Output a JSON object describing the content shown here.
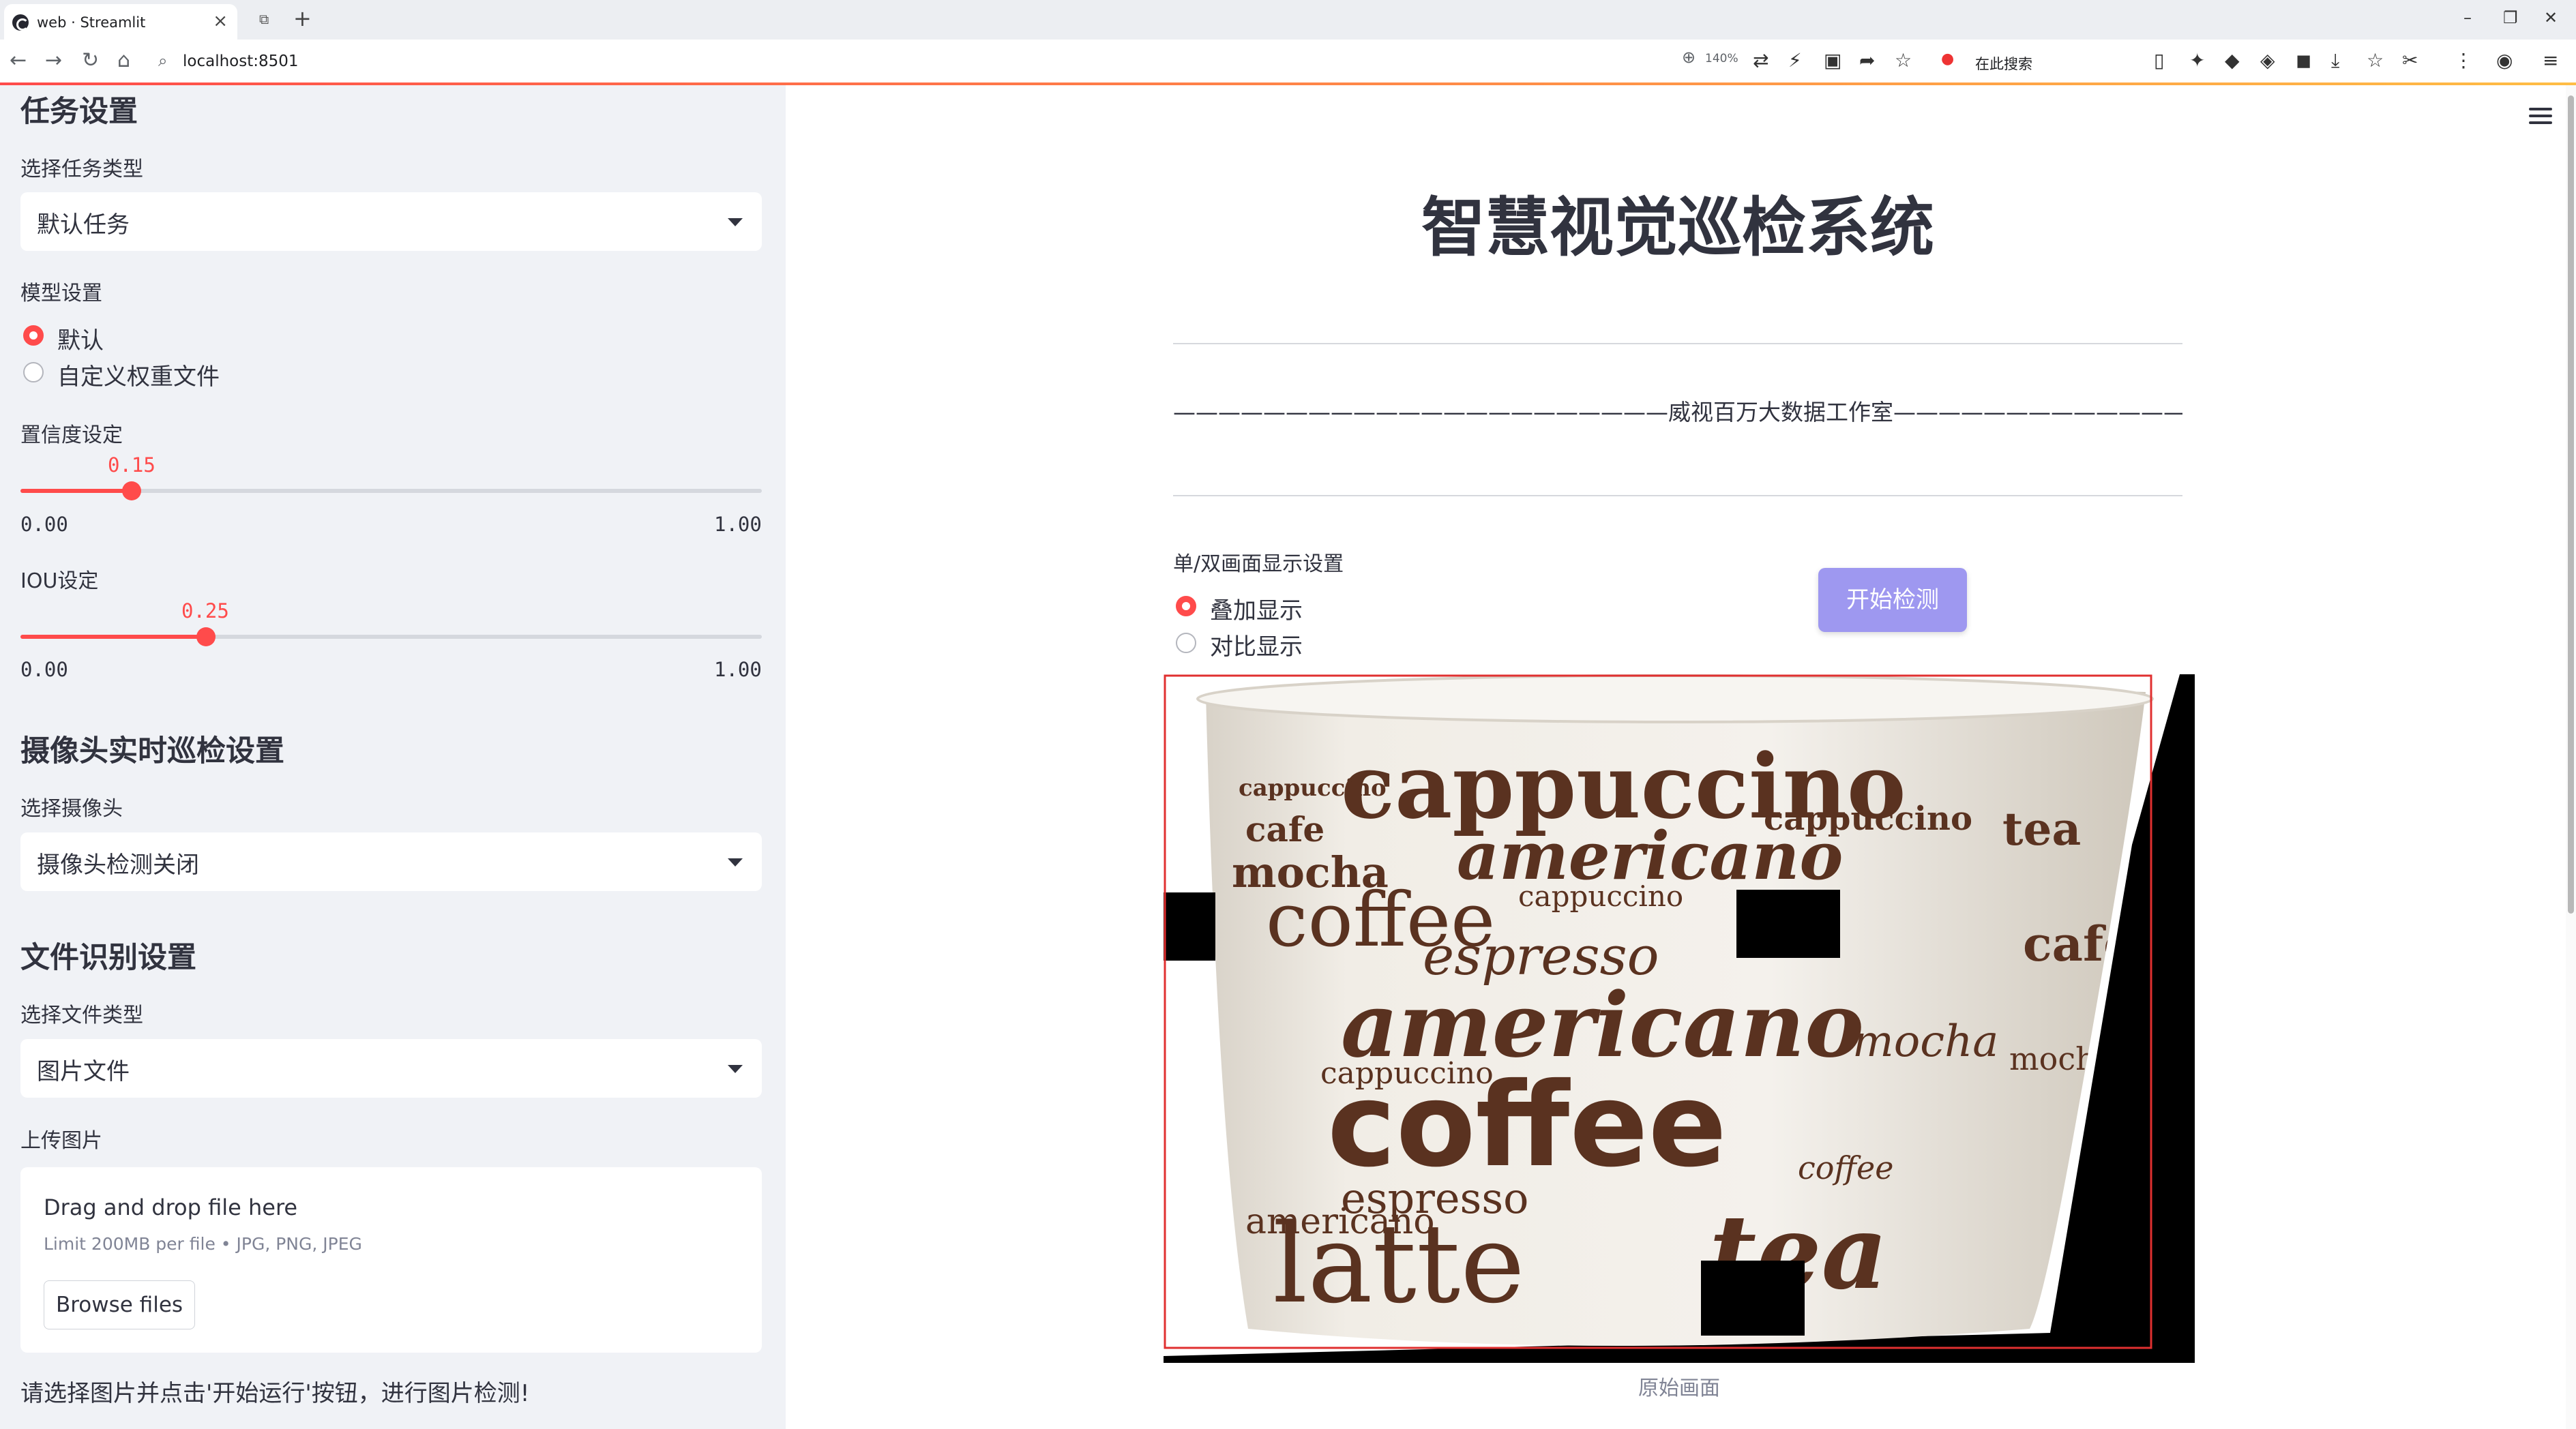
{
  "browser": {
    "tab_title": "web · Streamlit",
    "url": "localhost:8501",
    "zoom": "140%",
    "search_placeholder": "在此搜索"
  },
  "sidebar": {
    "task_section_title": "任务设置",
    "task_type_label": "选择任务类型",
    "task_type_value": "默认任务",
    "model_label": "模型设置",
    "model_options": [
      "默认",
      "自定义权重文件"
    ],
    "model_selected": 0,
    "confidence_label": "置信度设定",
    "confidence_value": "0.15",
    "confidence_min": "0.00",
    "confidence_max": "1.00",
    "iou_label": "IOU设定",
    "iou_value": "0.25",
    "iou_min": "0.00",
    "iou_max": "1.00",
    "camera_section_title": "摄像头实时巡检设置",
    "camera_label": "选择摄像头",
    "camera_value": "摄像头检测关闭",
    "file_section_title": "文件识别设置",
    "file_type_label": "选择文件类型",
    "file_type_value": "图片文件",
    "upload_label": "上传图片",
    "upload_drag_text": "Drag and drop file here",
    "upload_limit_text": "Limit 200MB per file • JPG, PNG, JPEG",
    "browse_button": "Browse files",
    "hint_text": "请选择图片并点击'开始运行'按钮，进行图片检测!"
  },
  "main": {
    "title": "智慧视觉巡检系统",
    "studio_line": "——————————————————————威视百万大数据工作室————————————————————————",
    "display_label": "单/双画面显示设置",
    "display_options": [
      "叠加显示",
      "对比显示"
    ],
    "display_selected": 0,
    "start_button": "开始检测",
    "image_caption": "原始画面"
  },
  "cup_words": [
    "cappuccino",
    "cappuccino",
    "cafe",
    "americano",
    "tea",
    "mocha",
    "coffee",
    "cappuccino",
    "espresso",
    "cafe",
    "americano",
    "americano",
    "mocha",
    "cappuccino",
    "coffee",
    "espresso",
    "coffee",
    "latte",
    "tea",
    "cappuccino",
    "mocha"
  ],
  "colors": {
    "accent": "#ff4b4b",
    "sidebar_bg": "#f0f2f6",
    "button_primary": "#9e98f0",
    "detection_box": "#e03030",
    "cup_text": "#5a3220"
  }
}
